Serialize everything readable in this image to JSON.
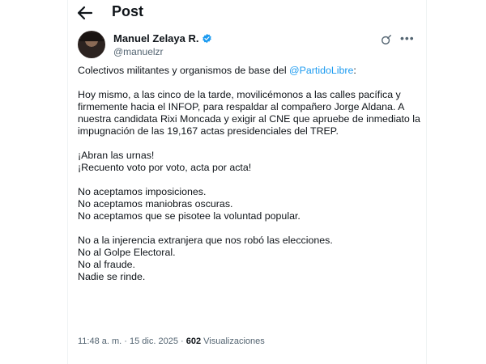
{
  "header": {
    "title": "Post"
  },
  "author": {
    "display_name": "Manuel Zelaya R.",
    "handle": "@manuelzr",
    "verified_color": "#1d9bf0"
  },
  "tweet": {
    "intro_before_mention": "Colectivos militantes y organismos de base del ",
    "mention": "@PartidoLibre",
    "intro_after_mention": ":",
    "paragraph_1": "Hoy mismo, a las cinco de la tarde, movilicémonos a las calles pacífica y firmemente hacia el INFOP, para respaldar al compañero Jorge Aldana. A nuestra candidata Rixi Moncada y exigir al CNE que apruebe de inmediato la impugnación de las 19,167 actas presidenciales del TREP.",
    "lines_2": [
      "¡Abran las urnas!",
      "¡Recuento voto por voto, acta por acta!"
    ],
    "lines_3": [
      "No aceptamos imposiciones.",
      "No aceptamos maniobras oscuras.",
      "No aceptamos que se pisotee la voluntad popular."
    ],
    "lines_4": [
      "No a la injerencia extranjera que nos robó las elecciones.",
      "No al Golpe Electoral.",
      "No al fraude.",
      "Nadie se rinde."
    ]
  },
  "meta": {
    "time": "11:48 a. m.",
    "separator": " · ",
    "date": "15 dic. 2025",
    "views_count": "602",
    "views_label": " Visualizaciones"
  },
  "colors": {
    "link": "#1d9bf0",
    "secondary_text": "#536471",
    "primary_text": "#0f1419"
  },
  "icons": {
    "back": "arrow-left-icon",
    "verified": "verified-badge-icon",
    "grok": "grok-icon",
    "more": "more-icon"
  }
}
